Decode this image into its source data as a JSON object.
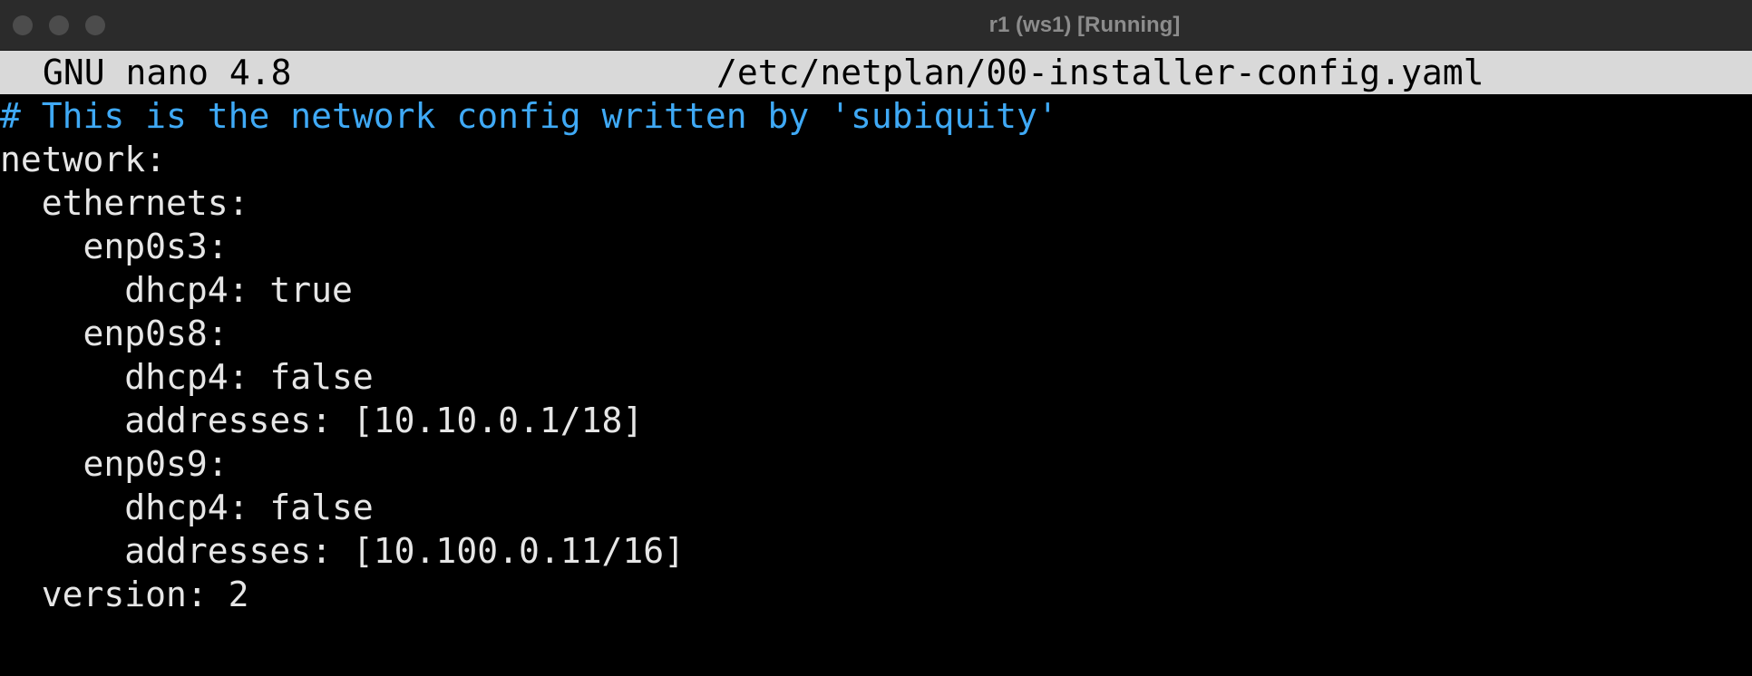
{
  "window": {
    "title": "r1 (ws1) [Running]",
    "title_color": "#8c8c8c",
    "titlebar_color": "#2b2b2b"
  },
  "nano": {
    "version_label": "GNU nano 4.8",
    "filename": "/etc/netplan/00-installer-config.yaml",
    "header_bg": "#d9d9d9"
  },
  "buffer": {
    "lines": [
      {
        "text": "# This is the network config written by 'subiquity'",
        "kind": "comment"
      },
      {
        "text": "network:",
        "kind": "code"
      },
      {
        "text": "  ethernets:",
        "kind": "code"
      },
      {
        "text": "    enp0s3:",
        "kind": "code"
      },
      {
        "text": "      dhcp4: true",
        "kind": "code"
      },
      {
        "text": "    enp0s8:",
        "kind": "code"
      },
      {
        "text": "      dhcp4: false",
        "kind": "code"
      },
      {
        "text": "      addresses: [10.10.0.1/18]",
        "kind": "code"
      },
      {
        "text": "    enp0s9:",
        "kind": "code"
      },
      {
        "text": "      dhcp4: false",
        "kind": "code"
      },
      {
        "text": "      addresses: [10.100.0.11/16]",
        "kind": "code"
      },
      {
        "text": "  version: 2",
        "kind": "code"
      }
    ],
    "comment_color": "#3fa9f5",
    "text_color": "#e6e6e6"
  }
}
